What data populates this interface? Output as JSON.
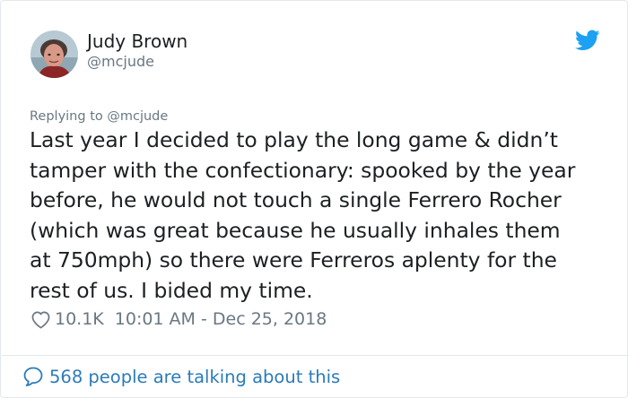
{
  "author": {
    "name": "Judy Brown",
    "handle": "@mcjude",
    "avatar_icon": "user-avatar-photo"
  },
  "brand": {
    "icon": "twitter-bird-icon",
    "color": "#1da1f2"
  },
  "tweet": {
    "replying_to": "Replying to @mcjude",
    "text": "Last year I decided to play the long game & didn’t\ntamper with the confectionary: spooked by the year\nbefore, he would not touch a single Ferrero Rocher\n(which was great because he usually inhales them\nat 750mph) so there were Ferreros aplenty for the\nrest of us. I bided my time.",
    "likes": "10.1K",
    "timestamp": "10:01 AM - Dec 25, 2018"
  },
  "footer": {
    "talking_label": "568 people are talking about this",
    "link_color": "#2b7bb9"
  }
}
